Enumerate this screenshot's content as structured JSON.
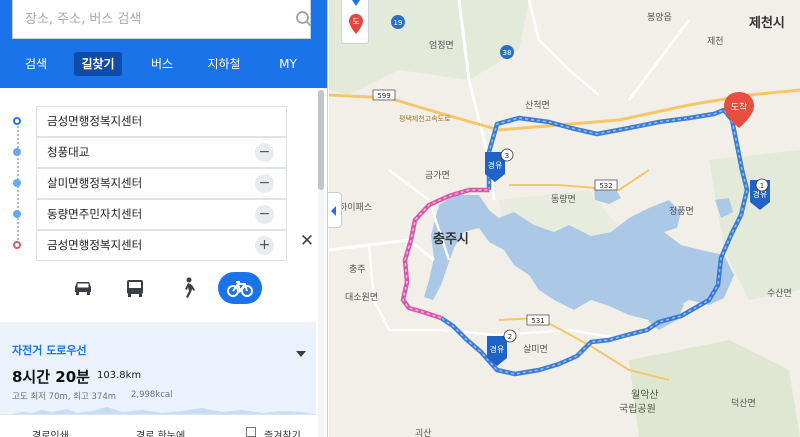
{
  "search": {
    "placeholder": "장소, 주소, 버스 검색"
  },
  "tabs": [
    "검색",
    "길찾기",
    "버스",
    "지하철",
    "MY"
  ],
  "waypoints": [
    "금성면행정복지센터",
    "청풍대교",
    "살미면행정복지센터",
    "동량면주민자치센터",
    "금성면행정복지센터"
  ],
  "route": {
    "type": "자전거 도로우선",
    "time": "8시간 20분",
    "distance": "103.8km",
    "elevation": "고도 최저 70m, 최고 374m",
    "kcal": "2,998kcal"
  },
  "bottom": {
    "print": "경로인쇄",
    "overview": "경로 한눈에",
    "favorite": "즐겨찾기"
  },
  "map": {
    "labels": {
      "chungju": "충주시",
      "jecheon": "제천시",
      "sancheok": "산척면",
      "eomjeong": "엄정면",
      "bongyang": "봉양읍",
      "jecheon_town": "제천",
      "geumga": "금가면",
      "dongnyang": "동량면",
      "cheongpung": "청풍면",
      "salmi": "살미면",
      "sansu": "수산면",
      "daeso": "대소원면",
      "chungju_town": "충주",
      "hwolaksan": "월악산",
      "park": "국립공원",
      "deoksan": "덕산면",
      "gwansan": "괴산",
      "hipass": "하이패스",
      "expressway": "평택제천고속도로"
    },
    "shields": [
      "19",
      "38",
      "599",
      "532",
      "531"
    ],
    "markers": {
      "gas": "경유",
      "arrival": "도착",
      "street": "도"
    },
    "waypoint_numbers": [
      "1",
      "2",
      "3"
    ]
  },
  "colors": {
    "accent": "#1a73e8",
    "route_blue": "#3a8ee6",
    "route_pink": "#e667b5",
    "water": "#abc9e6",
    "arrival_marker": "#ea4c3f"
  }
}
